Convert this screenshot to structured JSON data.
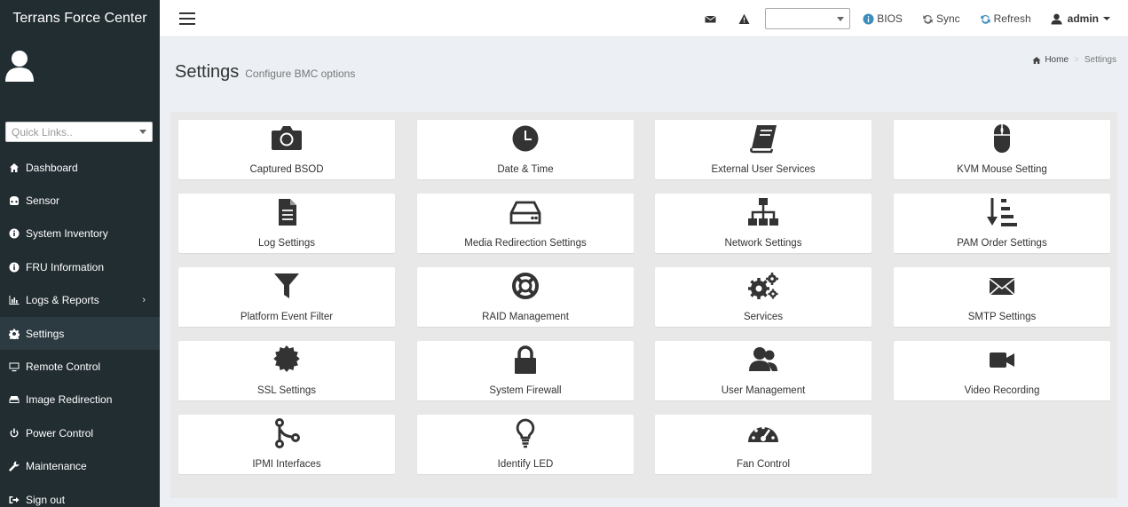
{
  "app": {
    "title": "Terrans Force Center"
  },
  "sidebar": {
    "quick_links_placeholder": "Quick Links..",
    "items": [
      {
        "label": "Dashboard",
        "icon": "dashboard-icon"
      },
      {
        "label": "Sensor",
        "icon": "sensor-icon"
      },
      {
        "label": "System Inventory",
        "icon": "info-icon"
      },
      {
        "label": "FRU Information",
        "icon": "info-icon"
      },
      {
        "label": "Logs & Reports",
        "icon": "bar-chart-icon"
      },
      {
        "label": "Settings",
        "icon": "gear-icon"
      },
      {
        "label": "Remote Control",
        "icon": "monitor-icon"
      },
      {
        "label": "Image Redirection",
        "icon": "drive-icon"
      },
      {
        "label": "Power Control",
        "icon": "power-icon"
      },
      {
        "label": "Maintenance",
        "icon": "wrench-icon"
      },
      {
        "label": "Sign out",
        "icon": "sign-out-icon"
      }
    ],
    "logs_arrow": "›"
  },
  "topbar": {
    "bios_label": "BIOS",
    "sync_label": "Sync",
    "refresh_label": "Refresh",
    "user_label": "admin",
    "accent_color": "#3c8dbc"
  },
  "header": {
    "title": "Settings",
    "subtitle": "Configure BMC options"
  },
  "breadcrumb": {
    "home": "Home",
    "sep": ">",
    "current": "Settings"
  },
  "tiles": [
    {
      "label": "Captured BSOD",
      "icon": "camera-icon"
    },
    {
      "label": "Date & Time",
      "icon": "clock-icon"
    },
    {
      "label": "External User Services",
      "icon": "book-icon"
    },
    {
      "label": "KVM Mouse Setting",
      "icon": "mouse-icon"
    },
    {
      "label": "Log Settings",
      "icon": "file-text-icon"
    },
    {
      "label": "Media Redirection Settings",
      "icon": "hdd-icon"
    },
    {
      "label": "Network Settings",
      "icon": "sitemap-icon"
    },
    {
      "label": "PAM Order Settings",
      "icon": "sort-amount-icon"
    },
    {
      "label": "Platform Event Filter",
      "icon": "filter-icon"
    },
    {
      "label": "RAID Management",
      "icon": "life-ring-icon"
    },
    {
      "label": "Services",
      "icon": "cogs-icon"
    },
    {
      "label": "SMTP Settings",
      "icon": "envelope-icon"
    },
    {
      "label": "SSL Settings",
      "icon": "certificate-icon"
    },
    {
      "label": "System Firewall",
      "icon": "lock-icon"
    },
    {
      "label": "User Management",
      "icon": "users-icon"
    },
    {
      "label": "Video Recording",
      "icon": "video-camera-icon"
    },
    {
      "label": "IPMI Interfaces",
      "icon": "code-fork-icon"
    },
    {
      "label": "Identify LED",
      "icon": "lightbulb-icon"
    },
    {
      "label": "Fan Control",
      "icon": "tachometer-icon"
    }
  ]
}
